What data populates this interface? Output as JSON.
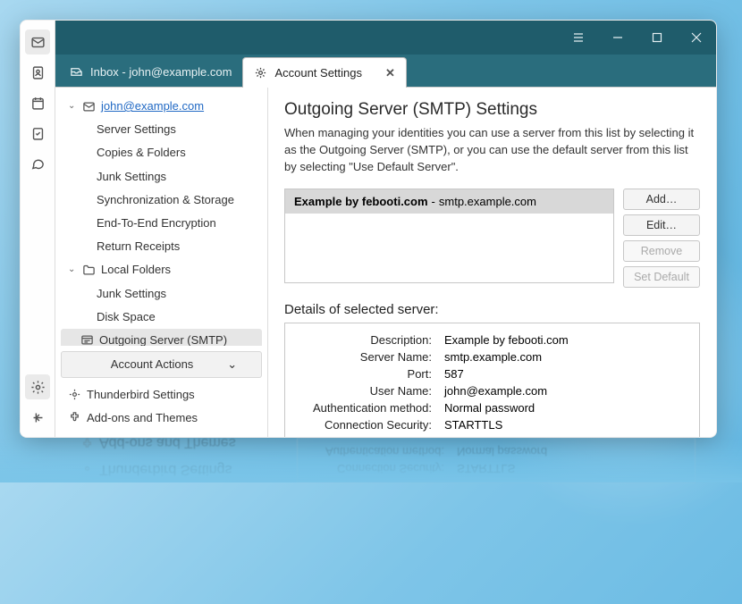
{
  "tabs": {
    "inbox_label": "Inbox - john@example.com",
    "settings_label": "Account Settings"
  },
  "tree": {
    "account_email": "john@example.com",
    "account_items": [
      "Server Settings",
      "Copies & Folders",
      "Junk Settings",
      "Synchronization & Storage",
      "End-To-End Encryption",
      "Return Receipts"
    ],
    "local_folders_label": "Local Folders",
    "local_items": [
      "Junk Settings",
      "Disk Space"
    ],
    "smtp_label": "Outgoing Server (SMTP)"
  },
  "sidebar": {
    "account_actions": "Account Actions",
    "thunderbird_settings": "Thunderbird Settings",
    "addons": "Add-ons and Themes"
  },
  "panel": {
    "title": "Outgoing Server (SMTP) Settings",
    "description": "When managing your identities you can use a server from this list by selecting it as the Outgoing Server (SMTP), or you can use the default server from this list by selecting \"Use Default Server\".",
    "server_entry_name": "Example by febooti.com",
    "server_entry_host": "smtp.example.com",
    "buttons": {
      "add": "Add…",
      "edit": "Edit…",
      "remove": "Remove",
      "set_default": "Set Default"
    },
    "details_heading": "Details of selected server:",
    "details": {
      "description_label": "Description:",
      "description_value": "Example by febooti.com",
      "server_name_label": "Server Name:",
      "server_name_value": "smtp.example.com",
      "port_label": "Port:",
      "port_value": "587",
      "user_name_label": "User Name:",
      "user_name_value": "john@example.com",
      "auth_label": "Authentication method:",
      "auth_value": "Normal password",
      "security_label": "Connection Security:",
      "security_value": "STARTTLS"
    }
  }
}
